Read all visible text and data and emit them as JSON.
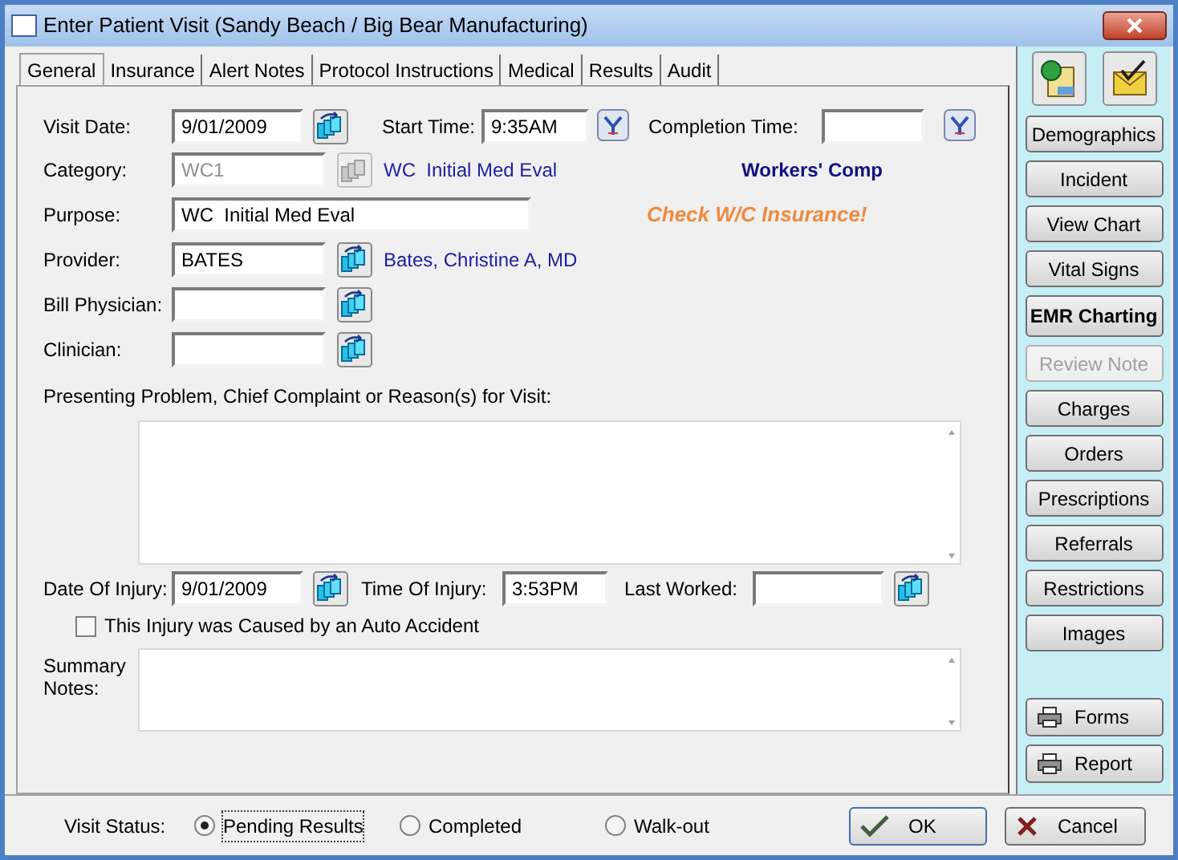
{
  "window": {
    "title": "Enter Patient Visit (Sandy Beach / Big Bear Manufacturing)"
  },
  "tabs": [
    {
      "label": "General",
      "selected": true
    },
    {
      "label": "Insurance",
      "selected": false
    },
    {
      "label": "Alert Notes",
      "selected": false
    },
    {
      "label": "Protocol Instructions",
      "selected": false
    },
    {
      "label": "Medical",
      "selected": false
    },
    {
      "label": "Results",
      "selected": false
    },
    {
      "label": "Audit",
      "selected": false
    }
  ],
  "visit_date": {
    "label": "Visit Date:",
    "value": "9/01/2009"
  },
  "start_time": {
    "label": "Start Time:",
    "value": "9:35AM"
  },
  "completion_time": {
    "label": "Completion Time:"
  },
  "category": {
    "label": "Category:",
    "value": "WC1",
    "disabled": true,
    "description": "WC  Initial Med Eval"
  },
  "insurance_type": "Workers' Comp",
  "purpose": {
    "label": "Purpose:",
    "value": "WC  Initial Med Eval"
  },
  "insurance_warning": "Check W/C Insurance!",
  "provider": {
    "label": "Provider:",
    "value": "BATES",
    "description": "Bates, Christine A, MD"
  },
  "bill_physician": {
    "label": "Bill Physician:"
  },
  "clinician": {
    "label": "Clinician:"
  },
  "presenting_problem": {
    "label": "Presenting Problem, Chief Complaint or Reason(s) for Visit:"
  },
  "date_of_injury": {
    "label": "Date Of Injury:",
    "value": "9/01/2009"
  },
  "time_of_injury": {
    "label": "Time Of Injury:",
    "value": "3:53PM"
  },
  "last_worked": {
    "label": "Last Worked:"
  },
  "auto_accident": {
    "label": "This Injury was Caused by an Auto Accident",
    "checked": false
  },
  "summary_notes": {
    "label": "Summary\nNotes:"
  },
  "visit_status": {
    "label": "Visit Status:",
    "options": [
      {
        "label": "Pending Results",
        "selected": true
      },
      {
        "label": "Completed",
        "selected": false
      },
      {
        "label": "Walk-out",
        "selected": false
      }
    ]
  },
  "side_buttons": [
    {
      "label": "Demographics",
      "kind": "normal",
      "disabled": false
    },
    {
      "label": "Incident",
      "kind": "normal",
      "disabled": false
    },
    {
      "label": "View Chart",
      "kind": "normal",
      "disabled": false
    },
    {
      "label": "Vital Signs",
      "kind": "normal",
      "disabled": false
    },
    {
      "label": "EMR Charting",
      "kind": "emphasis",
      "disabled": false
    },
    {
      "label": "Review Note",
      "kind": "normal",
      "disabled": true
    },
    {
      "label": "Charges",
      "kind": "normal",
      "disabled": false
    },
    {
      "label": "Orders",
      "kind": "normal",
      "disabled": false
    },
    {
      "label": "Prescriptions",
      "kind": "normal",
      "disabled": false
    },
    {
      "label": "Referrals",
      "kind": "normal",
      "disabled": false
    },
    {
      "label": "Restrictions",
      "kind": "normal",
      "disabled": false
    },
    {
      "label": "Images",
      "kind": "normal",
      "disabled": false
    }
  ],
  "print_buttons": [
    "Forms",
    "Report"
  ],
  "ok_button": "OK",
  "cancel_button": "Cancel"
}
